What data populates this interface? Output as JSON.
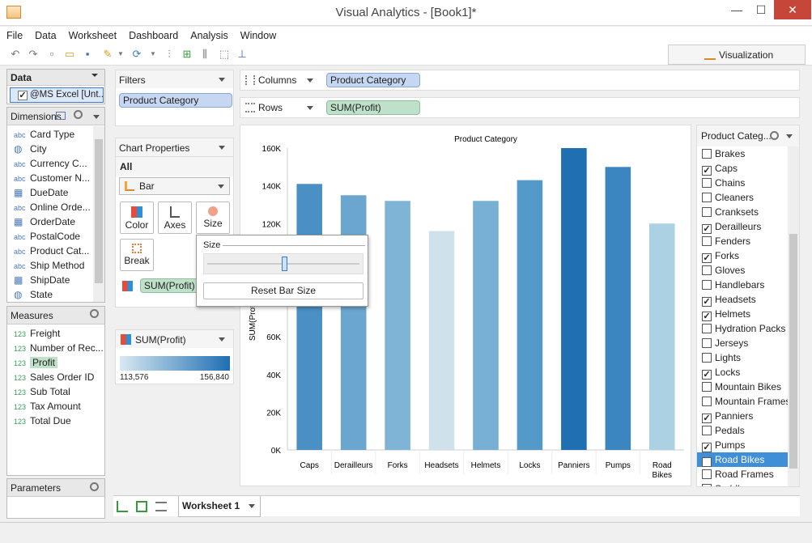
{
  "window": {
    "title": "Visual Analytics - [Book1]*",
    "min": "—",
    "max": "☐",
    "close": "✕"
  },
  "menu": [
    "File",
    "Data",
    "Worksheet",
    "Dashboard",
    "Analysis",
    "Window"
  ],
  "toolbar": {
    "viz_label": "Visualization"
  },
  "data_panel": {
    "title": "Data",
    "source": "@MS Excel [Unt..."
  },
  "dimensions": {
    "title": "Dimensions",
    "items": [
      {
        "type": "abc",
        "label": "Card Type"
      },
      {
        "type": "globe",
        "label": "City"
      },
      {
        "type": "abc",
        "label": "Currency C..."
      },
      {
        "type": "abc",
        "label": "Customer N..."
      },
      {
        "type": "date",
        "label": "DueDate"
      },
      {
        "type": "abc",
        "label": "Online Orde..."
      },
      {
        "type": "date",
        "label": "OrderDate"
      },
      {
        "type": "abc",
        "label": "PostalCode"
      },
      {
        "type": "abc",
        "label": "Product Cat..."
      },
      {
        "type": "abc",
        "label": "Ship Method"
      },
      {
        "type": "date",
        "label": "ShipDate"
      },
      {
        "type": "globe",
        "label": "State"
      }
    ]
  },
  "measures": {
    "title": "Measures",
    "items": [
      {
        "label": "Freight"
      },
      {
        "label": "Number of Rec..."
      },
      {
        "label": "Profit"
      },
      {
        "label": "Sales Order ID"
      },
      {
        "label": "Sub Total"
      },
      {
        "label": "Tax Amount"
      },
      {
        "label": "Total Due"
      }
    ],
    "type_label": "123"
  },
  "parameters": {
    "title": "Parameters"
  },
  "filters": {
    "title": "Filters",
    "pill": "Product Category"
  },
  "chart_props": {
    "title": "Chart Properties",
    "all": "All",
    "type": "Bar",
    "color": "Color",
    "axes": "Axes",
    "size": "Size",
    "break": "Break",
    "field": "SUM(Profit)"
  },
  "legend": {
    "field": "SUM(Profit)",
    "min": "113,576",
    "max": "156,840"
  },
  "shelves": {
    "columns_label": "Columns",
    "columns_pill": "Product Category",
    "rows_label": "Rows",
    "rows_pill": "SUM(Profit)"
  },
  "size_popup": {
    "title": "Size",
    "slider": 0.5,
    "reset": "Reset Bar Size"
  },
  "chart_data": {
    "type": "bar",
    "title": "Product Category",
    "ylabel": "SUM(Profit)",
    "ylim": [
      0,
      160000
    ],
    "yticks": [
      "0K",
      "20K",
      "40K",
      "60K",
      "80K",
      "100K",
      "120K",
      "140K",
      "160K"
    ],
    "categories": [
      "Caps",
      "Derailleurs",
      "Forks",
      "Headsets",
      "Helmets",
      "Locks",
      "Panniers",
      "Pumps",
      "Road Bikes"
    ],
    "values": [
      141000,
      135000,
      132000,
      116000,
      132000,
      143000,
      160000,
      150000,
      120000
    ],
    "colors": [
      "#4a90c4",
      "#6aa6cf",
      "#7fb4d6",
      "#cfe2ec",
      "#77b0d4",
      "#549ac9",
      "#1f6fb2",
      "#3b86c0",
      "#acd1e2"
    ]
  },
  "category_filter": {
    "title": "Product Categ...",
    "items": [
      {
        "label": "Brakes",
        "checked": false
      },
      {
        "label": "Caps",
        "checked": true
      },
      {
        "label": "Chains",
        "checked": false
      },
      {
        "label": "Cleaners",
        "checked": false
      },
      {
        "label": "Cranksets",
        "checked": false
      },
      {
        "label": "Derailleurs",
        "checked": true
      },
      {
        "label": "Fenders",
        "checked": false
      },
      {
        "label": "Forks",
        "checked": true
      },
      {
        "label": "Gloves",
        "checked": false
      },
      {
        "label": "Handlebars",
        "checked": false
      },
      {
        "label": "Headsets",
        "checked": true
      },
      {
        "label": "Helmets",
        "checked": true
      },
      {
        "label": "Hydration Packs",
        "checked": false
      },
      {
        "label": "Jerseys",
        "checked": false
      },
      {
        "label": "Lights",
        "checked": false
      },
      {
        "label": "Locks",
        "checked": true
      },
      {
        "label": "Mountain Bikes",
        "checked": false
      },
      {
        "label": "Mountain Frames",
        "checked": false
      },
      {
        "label": "Panniers",
        "checked": true
      },
      {
        "label": "Pedals",
        "checked": false
      },
      {
        "label": "Pumps",
        "checked": true
      },
      {
        "label": "Road Bikes",
        "checked": true
      },
      {
        "label": "Road Frames",
        "checked": false
      },
      {
        "label": "Saddles",
        "checked": false
      }
    ]
  },
  "tabs": {
    "worksheet": "Worksheet 1"
  }
}
